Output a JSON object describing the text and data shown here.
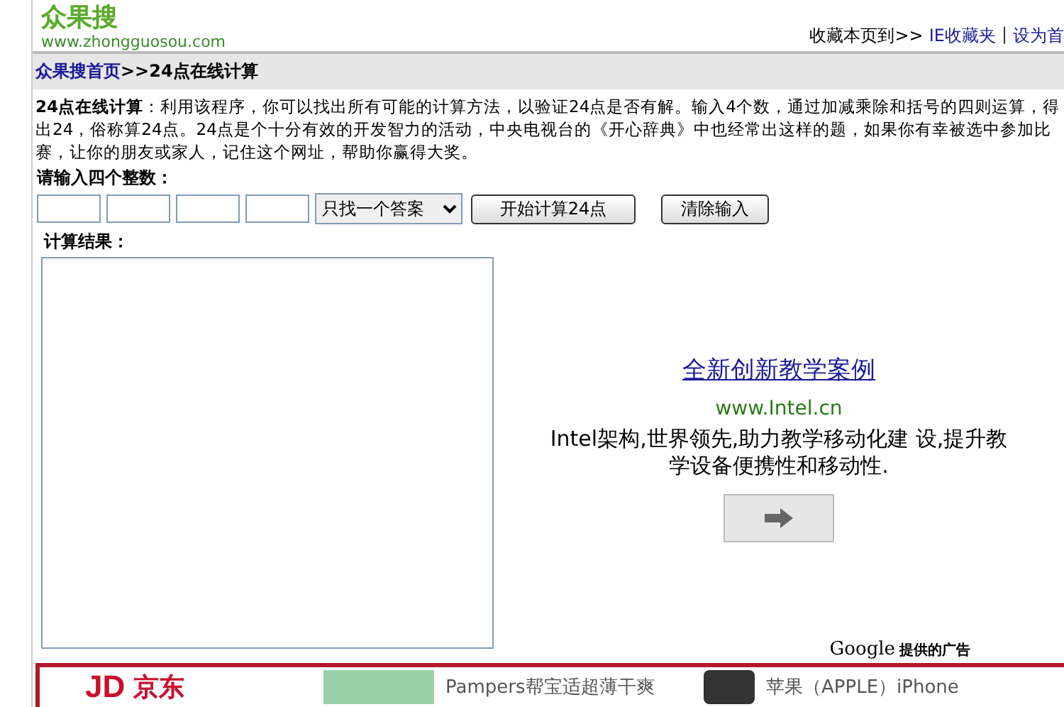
{
  "logo": {
    "name": "众果搜",
    "url": "www.zhongguosou.com"
  },
  "top_links": {
    "prefix": "收藏本页到>>",
    "links": [
      "IE收藏夹",
      "设为首"
    ],
    "separator": "|"
  },
  "breadcrumb": {
    "home": "众果搜首页",
    "current": ">>24点在线计算"
  },
  "intro": "**24点在线计算**：利用该程序，你可以找出所有可能的计算方法，以验证24点是否有解。输入4个数，通过加减乘除和括号的四则运算，得出24，俗称算24点。24点是个十分有效的开发智力的活动，中央电视台的《开心辞典》中也经常出这样的题，如果你有幸被选中参加比赛，让你的朋友或家人，记住这个网址，帮助你赢得大奖。",
  "prompt": "请输入四个整数：",
  "mode_select": {
    "value": "只找一个答案"
  },
  "buttons": [
    "开始计算24点",
    "清除输入"
  ],
  "result_label": "计算结果：",
  "ad": {
    "title": "全新创新教学案例",
    "url": "www.Intel.cn",
    "text": "Intel架构,世界领先,助力教学移动化建 设,提升教学设备便携性和移动性.",
    "brand": "Google",
    "attribution": "提供的广告"
  },
  "bottom_ads": [
    {
      "kind": "logo",
      "mark": "JD",
      "text": "京东"
    },
    {
      "kind": "product",
      "text": "Pampers帮宝适超薄干爽"
    },
    {
      "kind": "product",
      "text": "苹果（APPLE）iPhone"
    }
  ]
}
